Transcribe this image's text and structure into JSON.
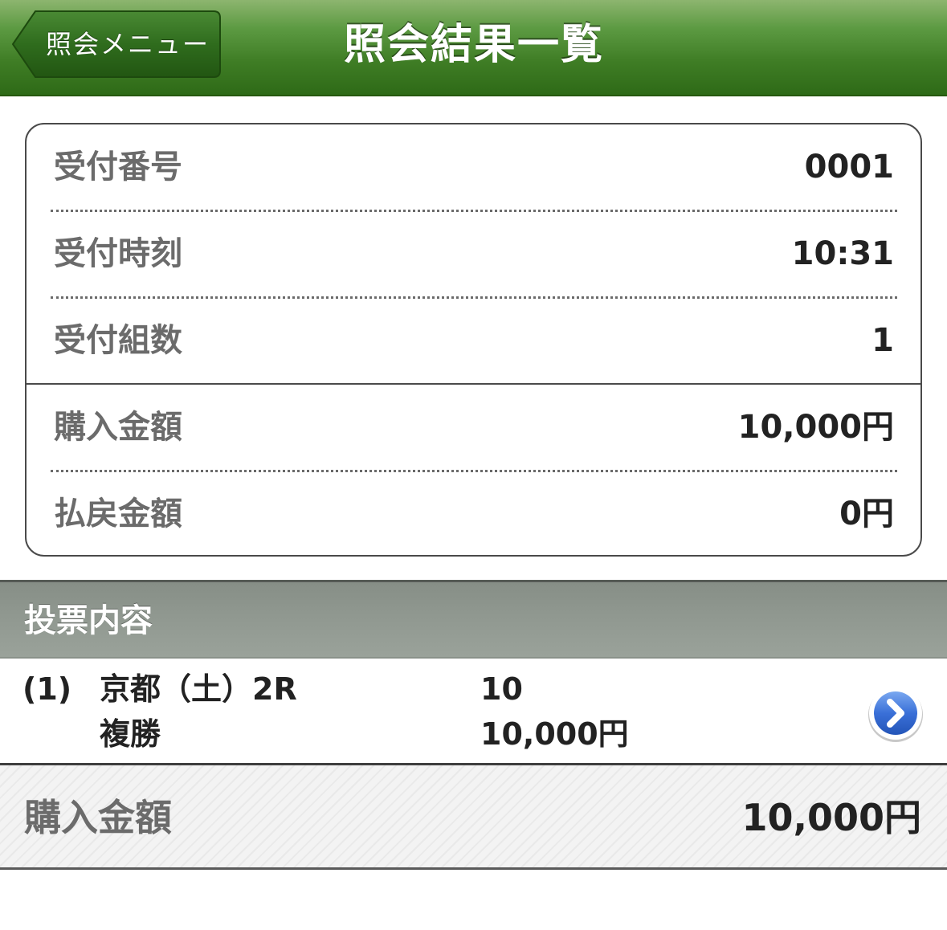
{
  "header": {
    "back_label": "照会メニュー",
    "title": "照会結果一覧",
    "bar_color": "#3f7d25"
  },
  "summary": {
    "receipt_number_label": "受付番号",
    "receipt_number": "0001",
    "receipt_time_label": "受付時刻",
    "receipt_time": "10:31",
    "receipt_sets_label": "受付組数",
    "receipt_sets": "1",
    "purchase_amount_label": "購入金額",
    "purchase_amount": "10,000円",
    "refund_amount_label": "払戻金額",
    "refund_amount": "0円"
  },
  "votes": {
    "section_title": "投票内容",
    "items": [
      {
        "index": "(1)",
        "race": "京都（土）2R",
        "bet_type": "複勝",
        "horse": "10",
        "amount": "10,000円",
        "detail_icon": "chevron-right-circle-icon"
      }
    ]
  },
  "total": {
    "label": "購入金額",
    "value": "10,000円"
  }
}
